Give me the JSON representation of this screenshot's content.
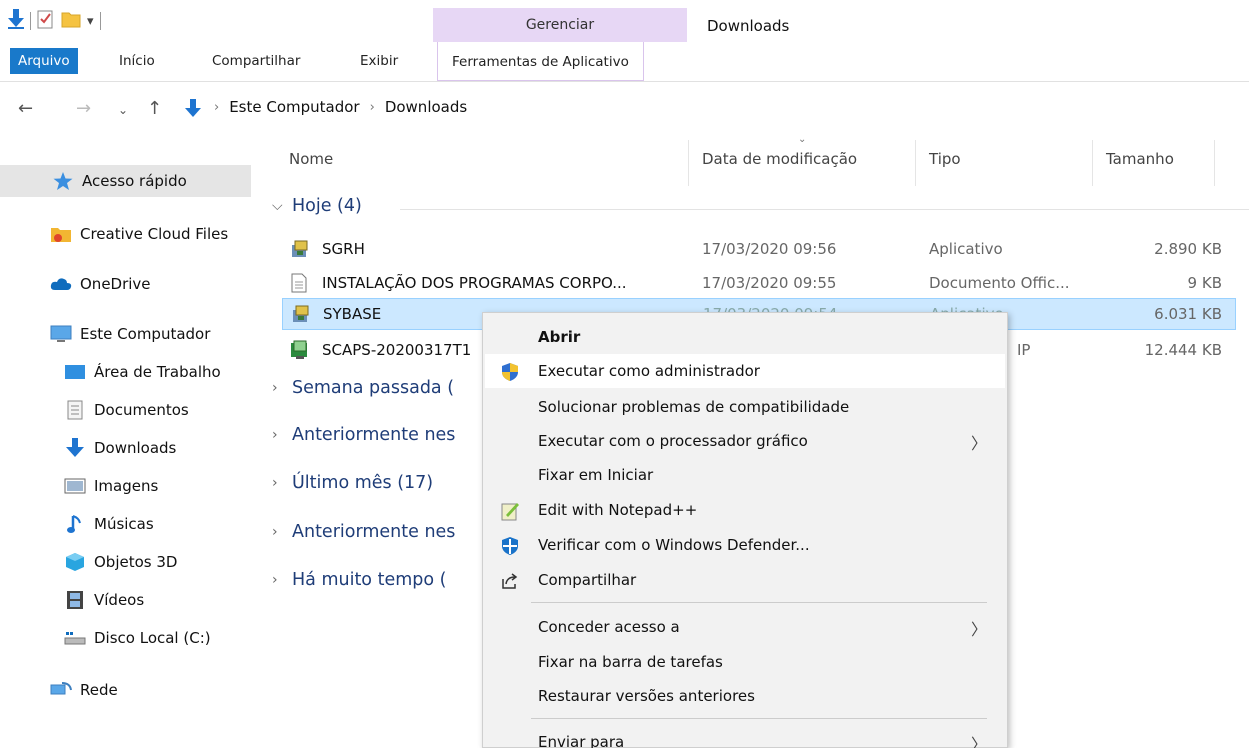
{
  "window": {
    "title": "Downloads"
  },
  "ribbon": {
    "context_group": "Gerenciar",
    "tabs": [
      "Arquivo",
      "Início",
      "Compartilhar",
      "Exibir"
    ],
    "context_tab": "Ferramentas de Aplicativo"
  },
  "address": {
    "crumbs": [
      "Este Computador",
      "Downloads"
    ]
  },
  "sidebar": {
    "items": [
      {
        "label": "Acesso rápido",
        "icon": "star-icon"
      },
      {
        "label": "Creative Cloud Files",
        "icon": "creative-cloud-folder-icon"
      },
      {
        "label": "OneDrive",
        "icon": "cloud-icon"
      },
      {
        "label": "Este Computador",
        "icon": "computer-icon"
      },
      {
        "label": "Área de Trabalho",
        "icon": "desktop-folder-icon"
      },
      {
        "label": "Documentos",
        "icon": "documents-icon"
      },
      {
        "label": "Downloads",
        "icon": "download-arrow-icon"
      },
      {
        "label": "Imagens",
        "icon": "pictures-icon"
      },
      {
        "label": "Músicas",
        "icon": "music-icon"
      },
      {
        "label": "Objetos 3D",
        "icon": "cube-icon"
      },
      {
        "label": "Vídeos",
        "icon": "film-icon"
      },
      {
        "label": "Disco Local (C:)",
        "icon": "drive-icon"
      },
      {
        "label": "Rede",
        "icon": "network-icon"
      }
    ]
  },
  "columns": {
    "name": "Nome",
    "date": "Data de modificação",
    "type": "Tipo",
    "size": "Tamanho"
  },
  "groups": {
    "today": "Hoje (4)",
    "last_week": "Semana passada (",
    "earlier_1": "Anteriormente nes",
    "last_month": "Último mês (17)",
    "earlier_2": "Anteriormente nes",
    "long_ago": "Há muito tempo ("
  },
  "files": [
    {
      "name": "SGRH",
      "date": "17/03/2020 09:56",
      "type": "Aplicativo",
      "size": "2.890 KB",
      "icon": "installer-icon"
    },
    {
      "name": "INSTALAÇÃO DOS PROGRAMAS CORPO...",
      "date": "17/03/2020 09:55",
      "type": "Documento Offic...",
      "size": "9 KB",
      "icon": "document-icon"
    },
    {
      "name": "SYBASE",
      "date": "17/03/2020 09:54",
      "type": "Aplicativo",
      "size": "6.031 KB",
      "icon": "installer-icon"
    },
    {
      "name": "SCAPS-20200317T1",
      "date": "",
      "type": "IP",
      "size": "12.444 KB",
      "icon": "zip-icon"
    }
  ],
  "context_menu": {
    "items": [
      {
        "label": "Abrir",
        "bold": true
      },
      {
        "label": "Executar como administrador",
        "icon": "uac-shield-icon"
      },
      {
        "label": "Solucionar problemas de compatibilidade"
      },
      {
        "label": "Executar com o processador gráfico",
        "submenu": true
      },
      {
        "label": "Fixar em Iniciar"
      },
      {
        "label": "Edit with Notepad++",
        "icon": "notepad-plus-plus-icon"
      },
      {
        "label": "Verificar com o Windows Defender...",
        "icon": "defender-icon"
      },
      {
        "label": "Compartilhar",
        "icon": "share-icon"
      },
      {
        "label": "Conceder acesso a",
        "submenu": true
      },
      {
        "label": "Fixar na barra de tarefas"
      },
      {
        "label": "Restaurar versões anteriores"
      },
      {
        "label": "Enviar para",
        "submenu": true
      }
    ],
    "submenu_arrow": "〉"
  },
  "colors": {
    "accent": "#1979ca",
    "context_tab": "#e7d7f5",
    "selection": "#cce8ff",
    "group_text": "#1f3d78"
  }
}
